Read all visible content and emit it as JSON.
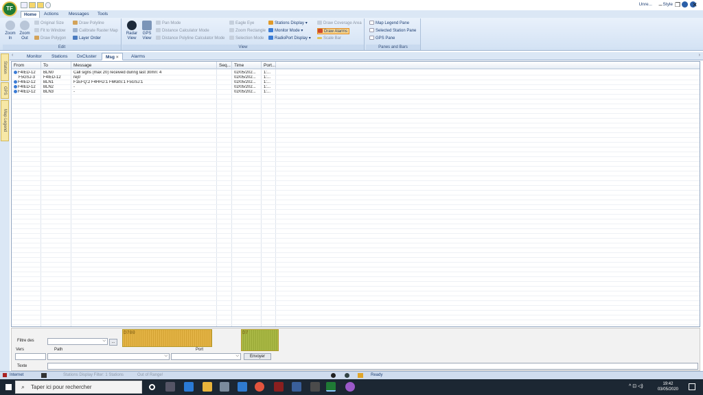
{
  "titlebar": {
    "app_initials": "TF",
    "right_user": "Unre...",
    "style_label": "Style"
  },
  "ribbon_tabs": [
    "Home",
    "Actions",
    "Messages",
    "Tools"
  ],
  "ribbon": {
    "edit": {
      "zoom_in": "Zoom In",
      "zoom_out": "Zoom Out",
      "original_size": "Original Size",
      "fit_to_window": "Fit to Window",
      "draw_polygon": "Draw Polygon",
      "draw_polyline": "Draw Polyline",
      "calibrate_raster": "Calibrate Raster Map",
      "layer_order": "Layer Order",
      "group_label": "Edit"
    },
    "view": {
      "radar_view": "Radar View",
      "gps_view": "GPS View",
      "pan_mode": "Pan Mode",
      "distance_calculator": "Distance Calculator Mode",
      "distance_polyline": "Distance Polyline Calculator Mode",
      "eagle_eye": "Eagle Eye",
      "zoom_rectangle": "Zoom Rectangle",
      "selection_mode": "Selection Mode",
      "stations_display": "Stations Display",
      "monitor_mode": "Monitor Mode",
      "radioport_display": "RadioPort Display",
      "draw_coverage": "Draw Coverage Area",
      "draw_alarms": "Draw Alarms",
      "scale_bar": "Scale Bar",
      "group_label": "View"
    },
    "panes": {
      "map_legend": "Map Legend Pane",
      "selected_station": "Selected Station Pane",
      "gps_pane": "GPS Pane",
      "group_label": "Panes and Bars"
    }
  },
  "side_tabs": [
    "Station",
    "GPS",
    "Map Legend"
  ],
  "doc_tabs": [
    "Monitor",
    "Stations",
    "DxCluster",
    "Msg",
    "Alarms"
  ],
  "doc_tab_close": "×",
  "grid": {
    "columns": [
      "From",
      "To",
      "Message",
      "Seq...",
      "Time",
      "Port..."
    ],
    "rows": [
      {
        "from": "F4IED-12",
        "to": "BLN0",
        "message": "Call signs (max 20) received during last 30mn: 4",
        "seq": "",
        "time": "02/05/202...",
        "port": "1:..."
      },
      {
        "from": "F5GSJ-3",
        "to": "F4IED-12",
        "message": "rej0",
        "seq": "",
        "time": "02/05/202...",
        "port": "1:..."
      },
      {
        "from": "F4IED-12",
        "to": "BLN1",
        "message": "F1EFQ:2 F4HFD:1 F6KBS:1 F5GSJ:1",
        "seq": "",
        "time": "02/05/202...",
        "port": "1:..."
      },
      {
        "from": "F4IED-12",
        "to": "BLN2",
        "message": "-",
        "seq": "",
        "time": "02/05/202...",
        "port": "1:..."
      },
      {
        "from": "F4IED-12",
        "to": "BLN3",
        "message": "-",
        "seq": "",
        "time": "02/05/202...",
        "port": "1:..."
      }
    ]
  },
  "compose": {
    "filtre_label": "Filtre des",
    "more_button": "...",
    "vers_label": "Vers",
    "path_label": "Path",
    "port_label": "Port",
    "send_button": "Envoyer",
    "texte_label": "Texte",
    "gauge1": "D700",
    "gauge2": "D7"
  },
  "status": {
    "internet": "Internet",
    "filter": "Stations Display Filter: 1 Stations",
    "range": "Out of Range!",
    "ready": "Ready"
  },
  "taskbar": {
    "search_placeholder": "Taper ici pour rechercher",
    "time": "19:42",
    "date": "03/05/2020"
  }
}
